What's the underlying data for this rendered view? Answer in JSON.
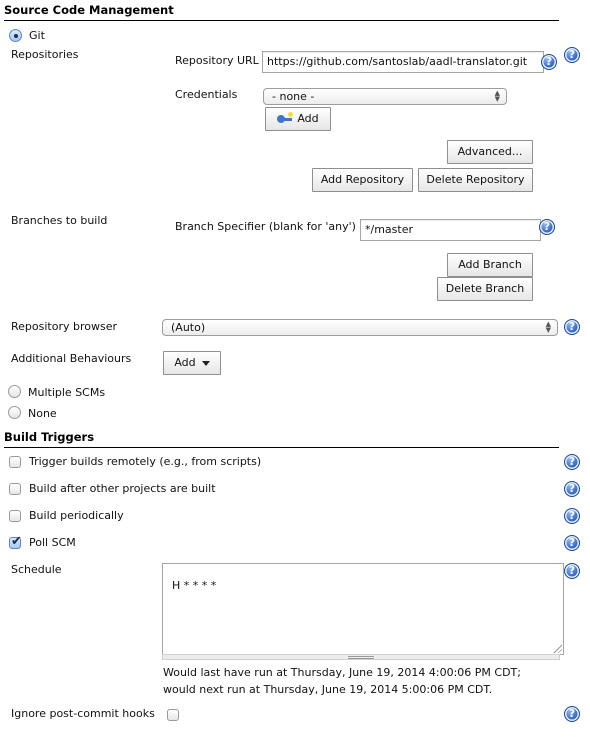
{
  "scm": {
    "section_title": "Source Code Management",
    "options": {
      "git": {
        "label": "Git",
        "selected": true
      },
      "multiple_scms": {
        "label": "Multiple SCMs",
        "selected": false
      },
      "none": {
        "label": "None",
        "selected": false
      }
    },
    "repositories_label": "Repositories",
    "repository_url_label": "Repository URL",
    "repository_url_value": "https://github.com/santoslab/aadl-translator.git",
    "credentials_label": "Credentials",
    "credentials_selected": "- none -",
    "add_credentials_label": "Add",
    "advanced_label": "Advanced...",
    "add_repository_label": "Add Repository",
    "delete_repository_label": "Delete Repository",
    "branches_label": "Branches to build",
    "branch_specifier_label": "Branch Specifier (blank for 'any')",
    "branch_specifier_value": "*/master",
    "add_branch_label": "Add Branch",
    "delete_branch_label": "Delete Branch",
    "repository_browser_label": "Repository browser",
    "repository_browser_selected": "(Auto)",
    "additional_behaviours_label": "Additional Behaviours",
    "additional_behaviours_add_label": "Add"
  },
  "triggers": {
    "section_title": "Build Triggers",
    "items": [
      {
        "label": "Trigger builds remotely (e.g., from scripts)",
        "checked": false
      },
      {
        "label": "Build after other projects are built",
        "checked": false
      },
      {
        "label": "Build periodically",
        "checked": false
      },
      {
        "label": "Poll SCM",
        "checked": true
      }
    ],
    "schedule_label": "Schedule",
    "schedule_value": "H * * * *",
    "schedule_info_line1": "Would last have run at Thursday, June 19, 2014 4:00:06 PM CDT;",
    "schedule_info_line2": "would next run at Thursday, June 19, 2014 5:00:06 PM CDT.",
    "ignore_post_commit_label": "Ignore post-commit hooks",
    "ignore_post_commit_checked": false
  },
  "icons": {
    "help": "?",
    "checkmark": "✔",
    "select_up": "▲",
    "select_down": "▼"
  }
}
